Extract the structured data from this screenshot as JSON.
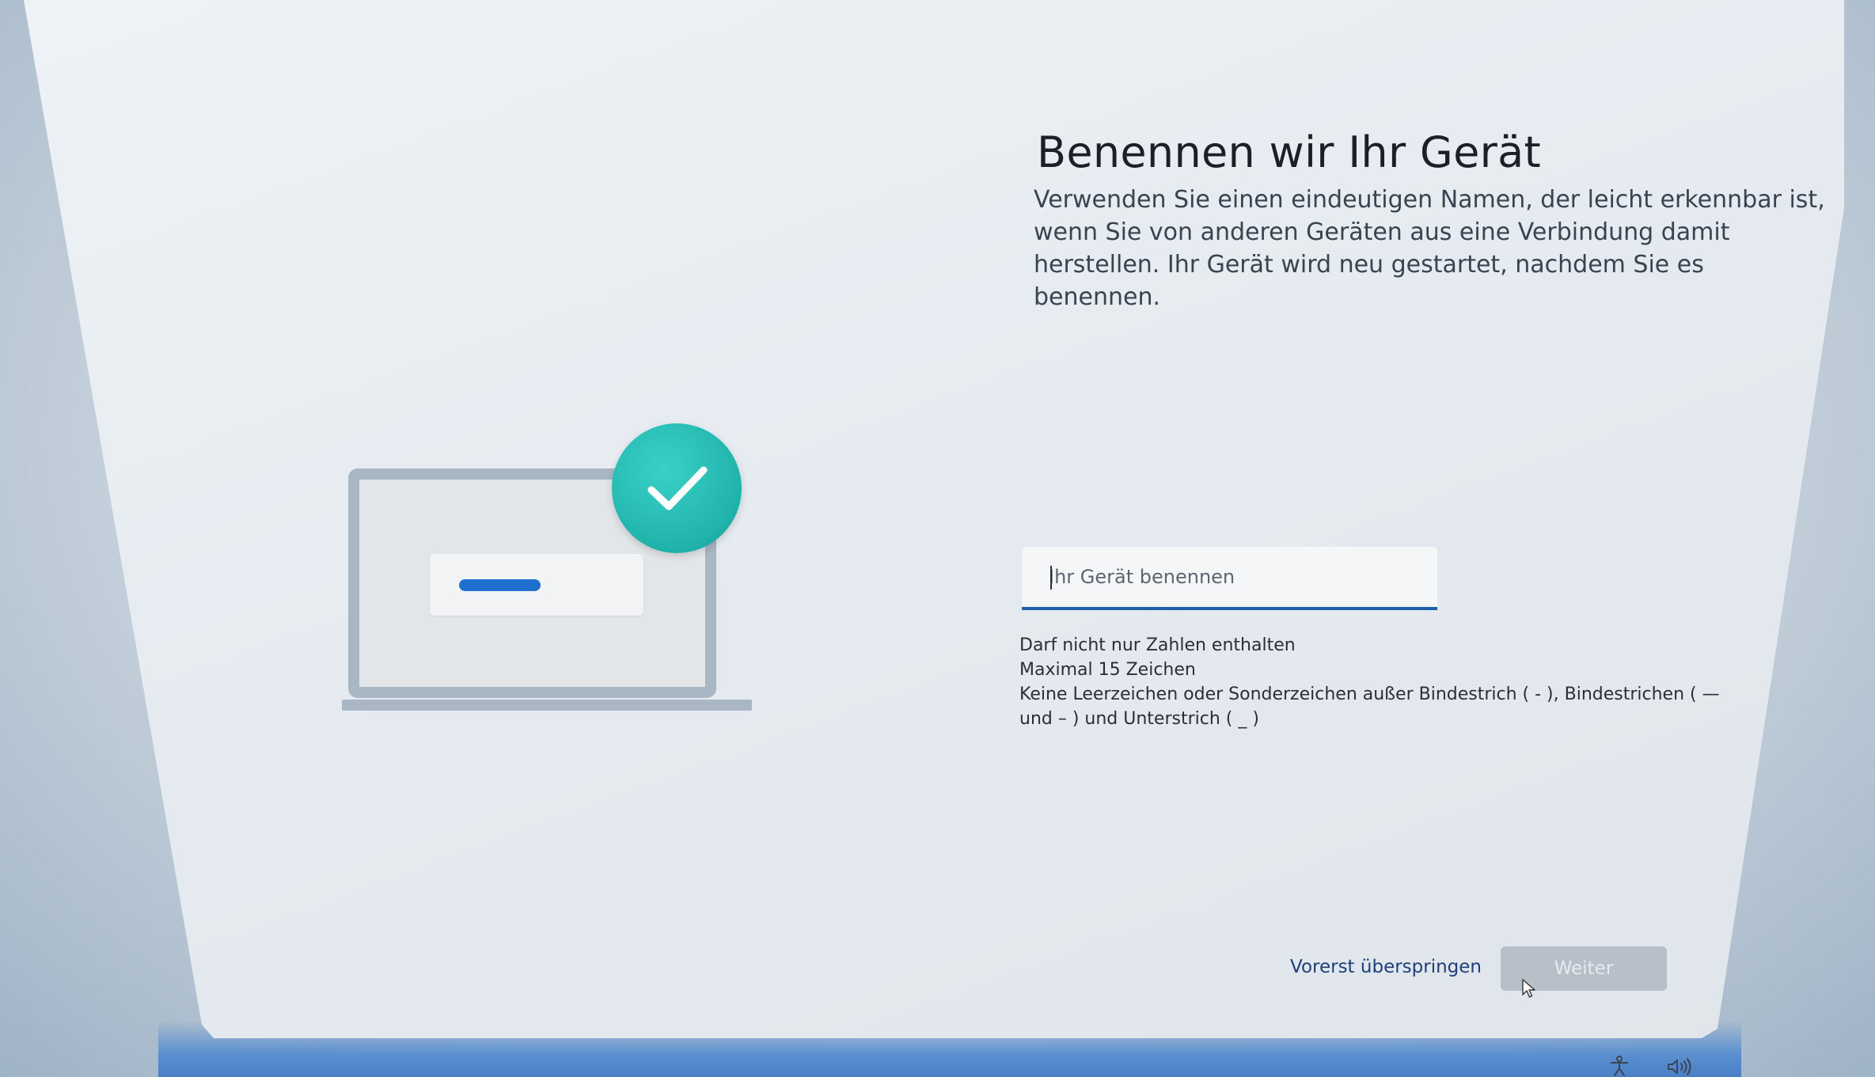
{
  "page": {
    "title": "Benennen wir Ihr Gerät",
    "description": "Verwenden Sie einen eindeutigen Namen, der leicht erkennbar ist, wenn Sie von anderen Geräten aus eine Verbindung damit herstellen. Ihr Gerät wird neu gestartet, nachdem Sie es benennen."
  },
  "name_field": {
    "placeholder": "Ihr Gerät benennen",
    "value": ""
  },
  "rules": [
    "Darf nicht nur Zahlen enthalten",
    "Maximal 15 Zeichen",
    "Keine Leerzeichen oder Sonderzeichen außer Bindestrich ( - ), Bindestrichen ( — und – ) und Unterstrich ( _ )"
  ],
  "actions": {
    "skip_label": "Vorerst überspringen",
    "next_label": "Weiter"
  },
  "colors": {
    "accent": "#1f5ea8",
    "badge": "#1fb3ab",
    "button_disabled": "#b7bfc8"
  },
  "icons": {
    "check": "checkmark-icon",
    "accessibility": "accessibility-icon",
    "volume": "volume-icon",
    "cursor": "mouse-pointer-icon"
  }
}
